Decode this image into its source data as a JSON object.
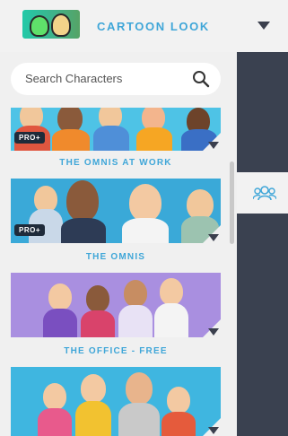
{
  "header": {
    "title": "CARTOON LOOK",
    "thumb_icon": "cartoon-look-thumbnail",
    "dropdown_icon": "caret-down-icon"
  },
  "search": {
    "placeholder": "Search Characters",
    "icon": "search-icon"
  },
  "sidebar": {
    "active_tab_icon": "people-icon"
  },
  "cards": [
    {
      "label": "THE OMNIS AT WORK",
      "badge": "PRO+",
      "bg": "#4ec3e6"
    },
    {
      "label": "THE OMNIS",
      "badge": "PRO+",
      "bg": "#3aa9d8"
    },
    {
      "label": "THE OFFICE - FREE",
      "badge": "",
      "bg": "#a98fe0"
    },
    {
      "label": "",
      "badge": "",
      "bg": "#3fb6e0"
    }
  ],
  "colors": {
    "accent": "#3fa6d8",
    "sidebar_dark": "#3a4150",
    "panel_bg": "#f0f0f0"
  }
}
